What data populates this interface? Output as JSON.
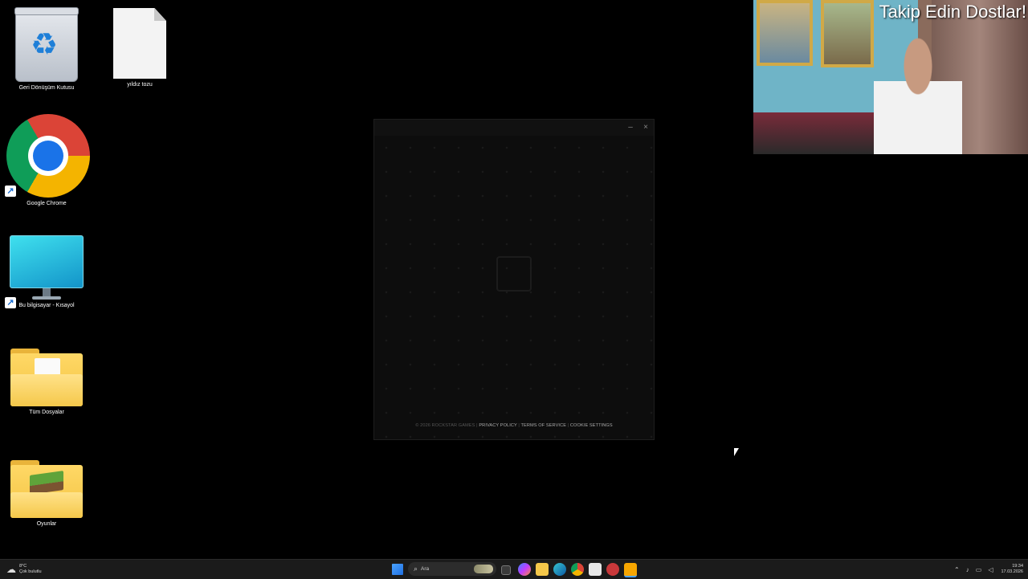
{
  "desktop": {
    "icons": [
      {
        "label": "Geri Dönüşüm Kutusu",
        "icon": "recycle-bin-icon"
      },
      {
        "label": "yıldız tozu",
        "icon": "text-document-icon"
      },
      {
        "label": "Google Chrome",
        "icon": "chrome-icon"
      },
      {
        "label": "Bu bilgisayar - Kısayol",
        "icon": "this-pc-icon"
      },
      {
        "label": "Tüm Dosyalar",
        "icon": "folder-icon"
      },
      {
        "label": "Oyunlar",
        "icon": "folder-icon"
      }
    ]
  },
  "launcher": {
    "minimize_symbol": "–",
    "close_symbol": "×",
    "footer": {
      "copyright": "© 2026 ROCKSTAR GAMES",
      "privacy": "PRIVACY POLICY",
      "terms": "TERMS OF SERVICE",
      "cookies": "COOKIE SETTINGS",
      "separator": " | "
    }
  },
  "webcam": {
    "overlay_text": "Takip Edin Dostlar!"
  },
  "taskbar": {
    "weather": {
      "temp": "8°C",
      "condition": "Çok bulutlu"
    },
    "search_placeholder": "Ara",
    "clock": {
      "time": "19:34",
      "date": "17.03.2026"
    },
    "apps": [
      "windows-start-icon",
      "search-icon",
      "widgets-icon",
      "task-view-icon",
      "copilot-icon",
      "file-explorer-icon",
      "edge-icon",
      "chrome-icon",
      "store-icon",
      "rockstar-social-club-icon",
      "rockstar-launcher-icon"
    ]
  },
  "colors": {
    "desktop_bg": "#000000",
    "taskbar_bg": "#1b1b1b",
    "launcher_bg": "#0d0d0d",
    "start_accent": "#2b7de9",
    "rockstar_accent": "#f7a600"
  }
}
